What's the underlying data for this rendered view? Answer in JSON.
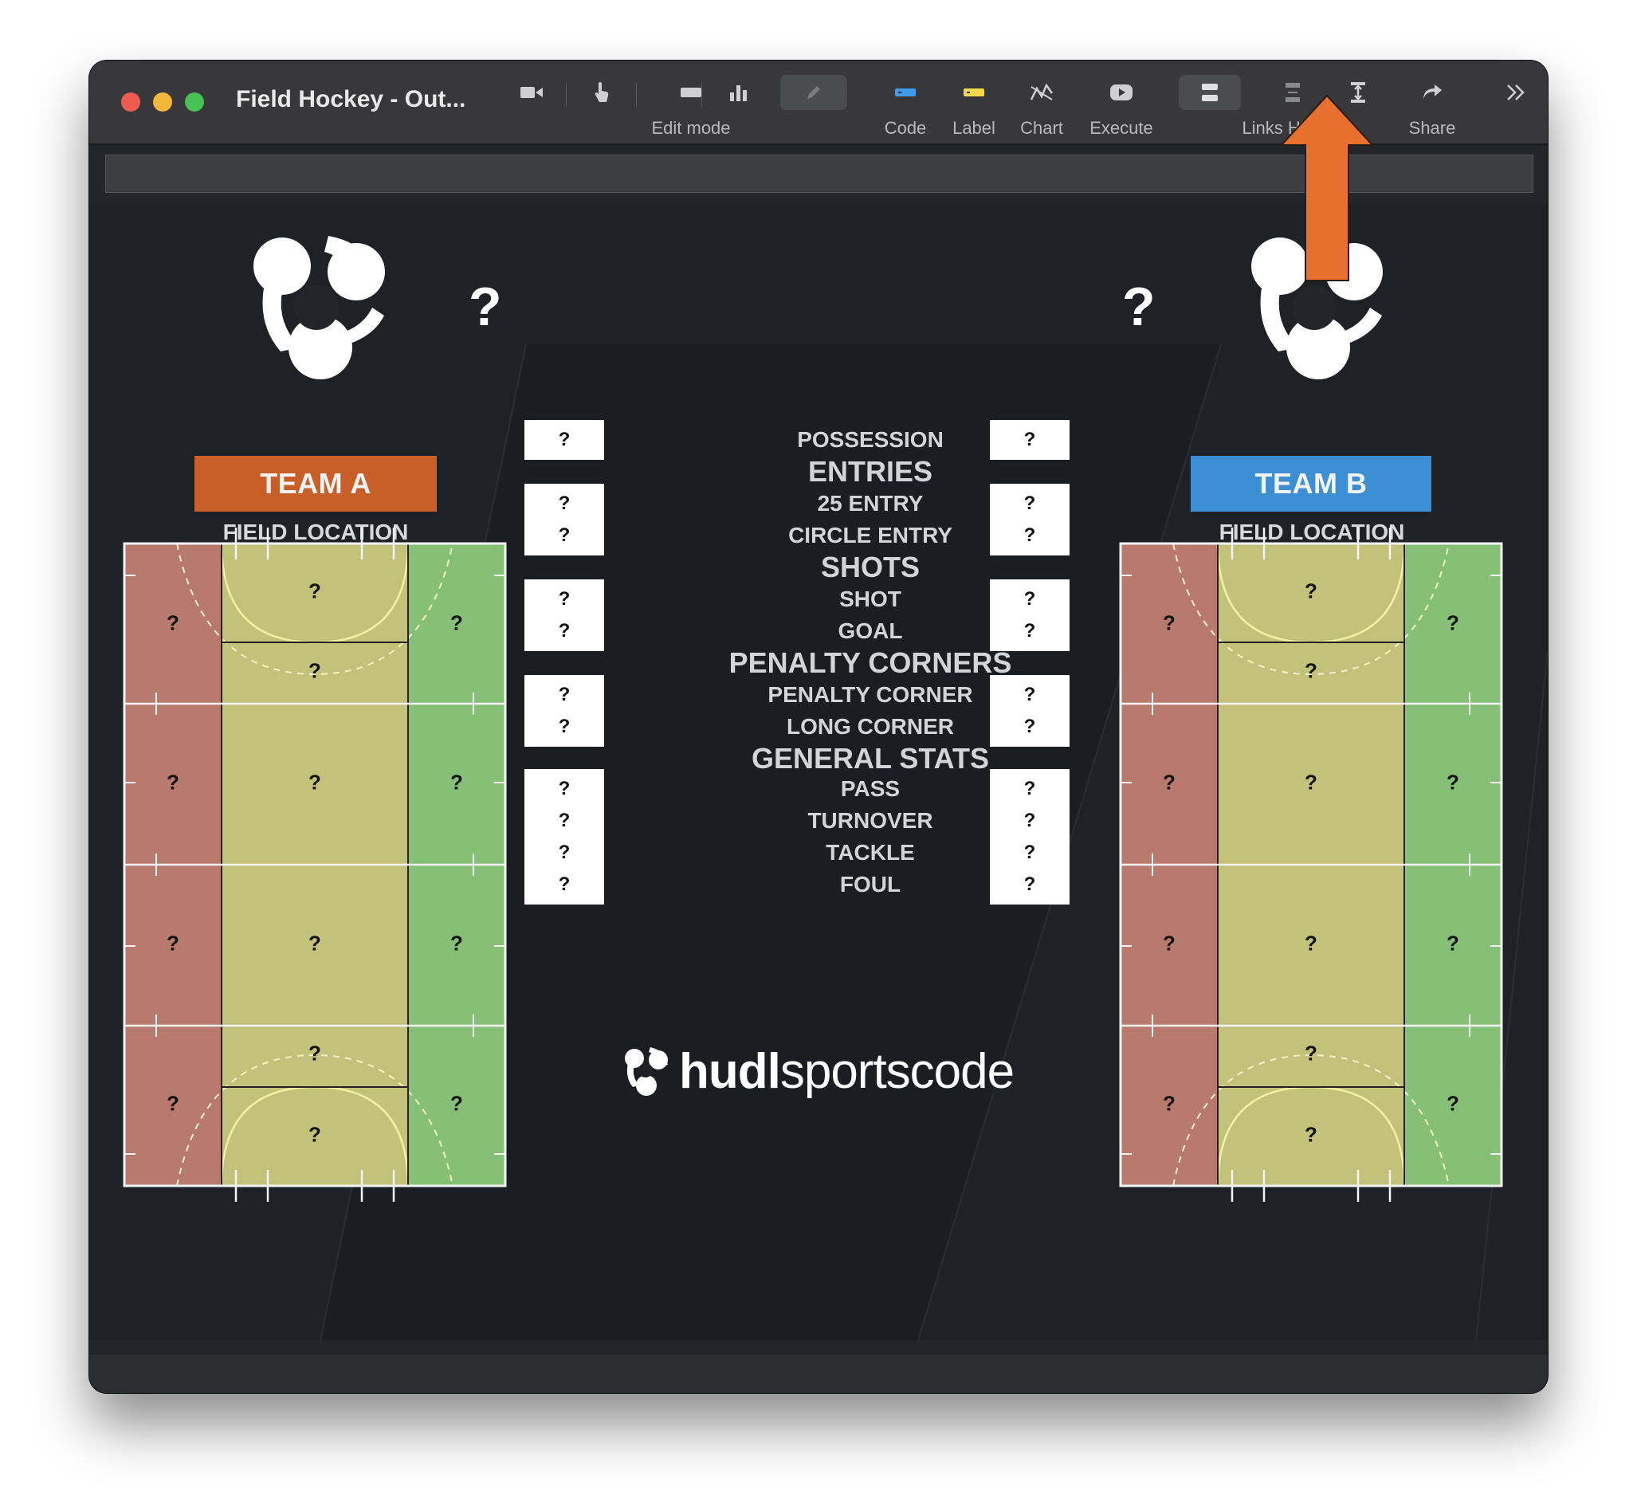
{
  "window": {
    "title": "Field Hockey - Out..."
  },
  "toolbar": {
    "items": [
      {
        "icon": "video-camera-icon",
        "label": ""
      },
      {
        "icon": "pointer-hand-icon",
        "label": ""
      },
      {
        "icon": "rectangle-button-icon",
        "label": "Edit mode"
      },
      {
        "icon": "bar-chart-icon",
        "label": ""
      },
      {
        "icon": "pencil-icon",
        "label": ""
      },
      {
        "icon": "code-button-icon",
        "label": "Code"
      },
      {
        "icon": "label-button-icon",
        "label": "Label"
      },
      {
        "icon": "chart-line-icon",
        "label": "Chart"
      },
      {
        "icon": "play-execute-icon",
        "label": "Execute"
      },
      {
        "icon": "links-show-icon",
        "label": "Links Hidden"
      },
      {
        "icon": "links-hide-icon",
        "label": ""
      },
      {
        "icon": "links-expand-icon",
        "label": ""
      },
      {
        "icon": "share-arrow-icon",
        "label": "Share"
      }
    ],
    "overflow_icon": "chevron-double-right-icon"
  },
  "teams": {
    "a": {
      "name": "TEAM A",
      "score": "?",
      "color": "#c85f29"
    },
    "b": {
      "name": "TEAM B",
      "score": "?",
      "color": "#3d8fd3"
    }
  },
  "field_location_label": "FIELD LOCATION",
  "field_zones": {
    "team_a": [
      "?",
      "?",
      "?",
      "?",
      "?",
      "?",
      "?",
      "?",
      "?",
      "?",
      "?",
      "?",
      "?",
      "?"
    ],
    "team_b": [
      "?",
      "?",
      "?",
      "?",
      "?",
      "?",
      "?",
      "?",
      "?",
      "?",
      "?",
      "?",
      "?",
      "?"
    ]
  },
  "stats": {
    "possession": {
      "label": "POSSESSION",
      "a": "?",
      "b": "?"
    },
    "entries_header": "ENTRIES",
    "entry_25": {
      "label": "25 ENTRY",
      "a": "?",
      "b": "?"
    },
    "circle_entry": {
      "label": "CIRCLE ENTRY",
      "a": "?",
      "b": "?"
    },
    "shots_header": "SHOTS",
    "shot": {
      "label": "SHOT",
      "a": "?",
      "b": "?"
    },
    "goal": {
      "label": "GOAL",
      "a": "?",
      "b": "?"
    },
    "pc_header": "PENALTY CORNERS",
    "penalty_corner": {
      "label": "PENALTY CORNER",
      "a": "?",
      "b": "?"
    },
    "long_corner": {
      "label": "LONG CORNER",
      "a": "?",
      "b": "?"
    },
    "general_header": "GENERAL STATS",
    "pass": {
      "label": "PASS",
      "a": "?",
      "b": "?"
    },
    "turnover": {
      "label": "TURNOVER",
      "a": "?",
      "b": "?"
    },
    "tackle": {
      "label": "TACKLE",
      "a": "?",
      "b": "?"
    },
    "foul": {
      "label": "FOUL",
      "a": "?",
      "b": "?"
    }
  },
  "brand": {
    "bold": "hudl",
    "regular": "sportscode"
  },
  "colors": {
    "zone_left": "#b87a6c",
    "zone_mid": "#c2c27a",
    "zone_right": "#86c076",
    "annotation_arrow": "#e8702e"
  }
}
